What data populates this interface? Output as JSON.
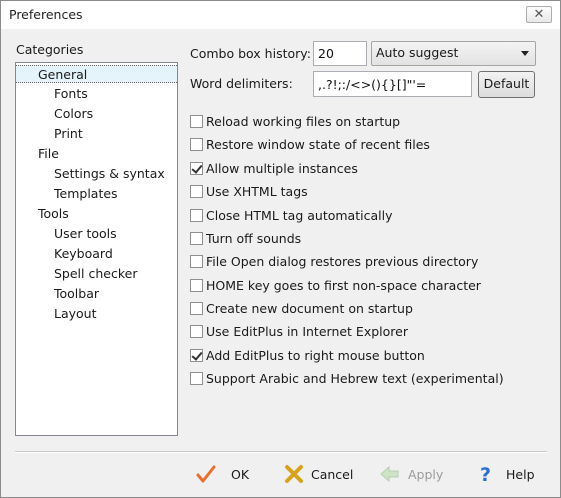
{
  "window": {
    "title": "Preferences",
    "close_glyph": "✕"
  },
  "categories": {
    "label": "Categories",
    "items": [
      {
        "label": "General",
        "level": 0,
        "selected": true
      },
      {
        "label": "Fonts",
        "level": 1
      },
      {
        "label": "Colors",
        "level": 1
      },
      {
        "label": "Print",
        "level": 1
      },
      {
        "label": "File",
        "level": 0
      },
      {
        "label": "Settings & syntax",
        "level": 1
      },
      {
        "label": "Templates",
        "level": 1
      },
      {
        "label": "Tools",
        "level": 0
      },
      {
        "label": "User tools",
        "level": 1
      },
      {
        "label": "Keyboard",
        "level": 1
      },
      {
        "label": "Spell checker",
        "level": 1
      },
      {
        "label": "Toolbar",
        "level": 1
      },
      {
        "label": "Layout",
        "level": 1
      }
    ]
  },
  "general": {
    "combo_history_label": "Combo box history:",
    "combo_history_value": "20",
    "autosuggest_value": "Auto suggest",
    "word_delimiters_label": "Word delimiters:",
    "word_delimiters_value": ",.?!;:/<>(){}[]\"'=",
    "default_button": "Default",
    "options": [
      {
        "label": "Reload working files on startup",
        "checked": false
      },
      {
        "label": "Restore window state of recent files",
        "checked": false
      },
      {
        "label": "Allow multiple instances",
        "checked": true
      },
      {
        "label": "Use XHTML tags",
        "checked": false
      },
      {
        "label": "Close HTML tag automatically",
        "checked": false
      },
      {
        "label": "Turn off sounds",
        "checked": false
      },
      {
        "label": "File Open dialog restores previous directory",
        "checked": false
      },
      {
        "label": "HOME key goes to first non-space character",
        "checked": false
      },
      {
        "label": "Create new document on startup",
        "checked": false
      },
      {
        "label": "Use EditPlus in Internet Explorer",
        "checked": false
      },
      {
        "label": "Add EditPlus to right mouse button",
        "checked": true
      },
      {
        "label": "Support Arabic and Hebrew text (experimental)",
        "checked": false
      }
    ]
  },
  "footer": {
    "ok": {
      "label": "OK",
      "icon": "checkmark-icon",
      "color": "#e8702a"
    },
    "cancel": {
      "label": "Cancel",
      "icon": "cross-icon",
      "color": "#d9a21b"
    },
    "apply": {
      "label": "Apply",
      "icon": "arrow-left-icon",
      "disabled": true
    },
    "help": {
      "label": "Help",
      "icon": "question-icon",
      "color": "#2b6fd6"
    }
  }
}
